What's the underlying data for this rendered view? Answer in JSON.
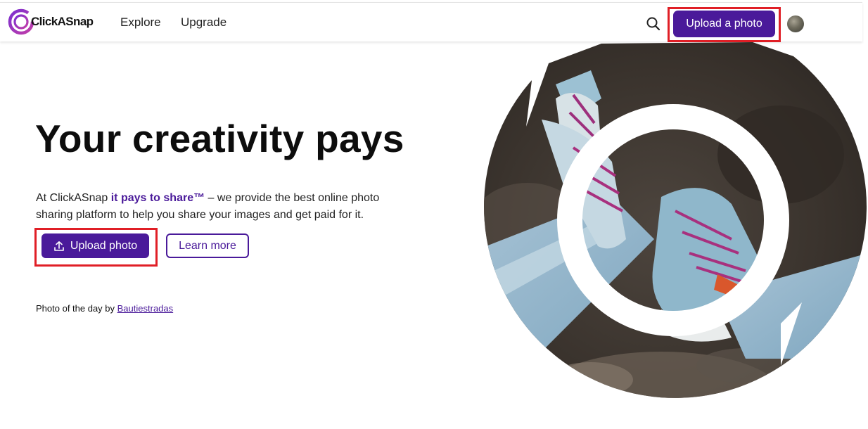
{
  "brand": {
    "name": "ClickASnap",
    "accent_color": "#4a1a9a",
    "highlight_color": "#e01f26"
  },
  "nav": {
    "explore_label": "Explore",
    "upgrade_label": "Upgrade",
    "search_icon": "search-icon",
    "upload_label": "Upload a photo",
    "avatar_icon": "user-avatar"
  },
  "hero": {
    "title": "Your creativity pays",
    "description_prefix": "At ClickASnap ",
    "description_accent": "it pays to share™",
    "description_suffix": " – we provide the best online photo sharing platform to help you share your images and get paid for it.",
    "upload_button_label": "Upload photo",
    "upload_icon": "upload-icon",
    "learn_more_label": "Learn more",
    "photo_of_day_prefix": "Photo of the day by ",
    "photo_of_day_author": "Bautiestradas"
  }
}
